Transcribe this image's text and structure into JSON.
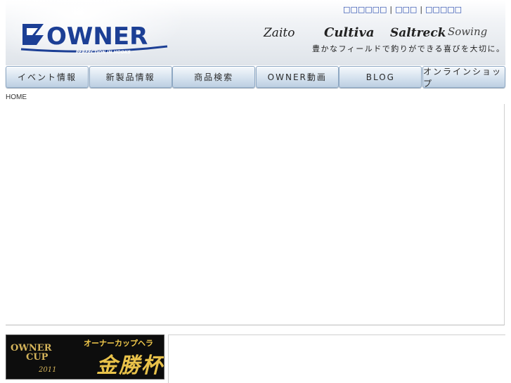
{
  "header": {
    "top_links": [
      "□□□□□□",
      "□□□",
      "□□□□□"
    ],
    "logo_text": "OWNER",
    "logo_sub": "PERFECTION IN HOOKS",
    "brands": [
      "Zaito",
      "Cultiva",
      "Saltreck",
      "Sowing"
    ],
    "tagline": "豊かなフィールドで釣りができる喜びを大切に。"
  },
  "nav": {
    "items": [
      "イベント情報",
      "新製品情報",
      "商品検索",
      "OWNER動画",
      "BLOG",
      "オンラインショップ"
    ]
  },
  "breadcrumb": "HOME",
  "banner": {
    "cup_line1": "OWNER",
    "cup_line2": "CUP",
    "year": "2011",
    "title": "オーナーカップヘラ",
    "kanji": "金勝杯"
  },
  "colors": {
    "link": "#1a3fa8",
    "logo_blue": "#1c3f95",
    "banner_gold": "#d4b35a"
  }
}
